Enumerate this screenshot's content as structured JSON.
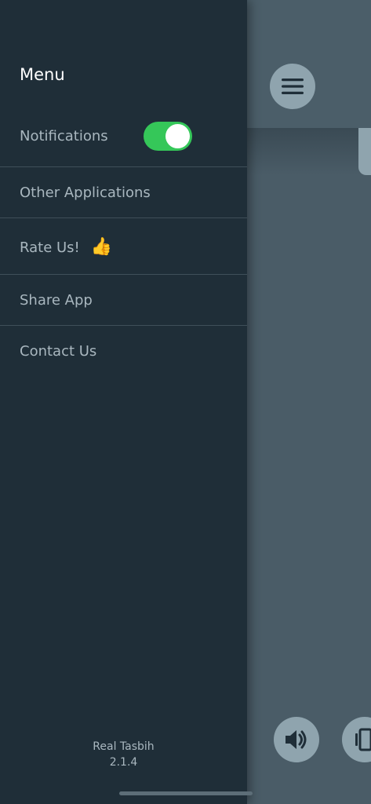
{
  "drawer": {
    "title": "Menu",
    "items": [
      {
        "label": "Notifications",
        "toggle_on": true
      },
      {
        "label": "Other Applications"
      },
      {
        "label": "Rate Us!",
        "emoji": "👍"
      },
      {
        "label": "Share App"
      },
      {
        "label": "Contact Us"
      }
    ],
    "footer": {
      "app_name": "Real Tasbih",
      "version": "2.1.4"
    }
  },
  "app": {
    "icons": [
      "hamburger-menu-icon",
      "speaker-icon",
      "vibrate-icon"
    ]
  },
  "colors": {
    "drawer_bg": "#1f2e38",
    "app_bg": "#4a5c67",
    "toggle_on": "#35c759",
    "button_bg": "#8fa4ae"
  }
}
